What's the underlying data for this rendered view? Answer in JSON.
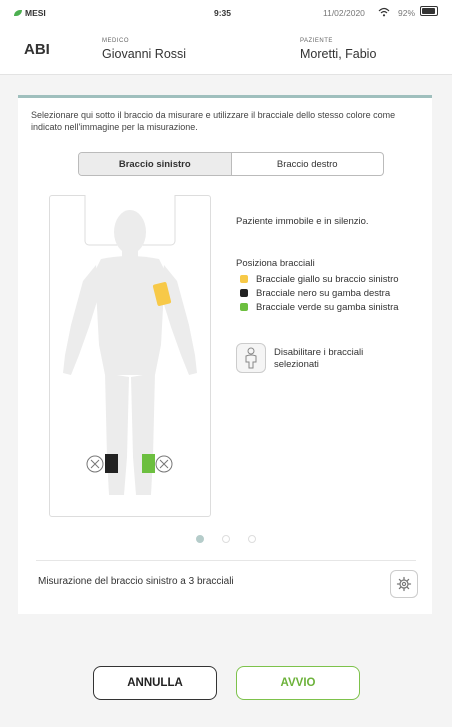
{
  "status_bar": {
    "carrier": "MESI",
    "time": "9:35",
    "date": "11/02/2020",
    "battery": "92%"
  },
  "header": {
    "app_title": "ABI",
    "doctor_label": "MEDICO",
    "doctor_name": "Giovanni Rossi",
    "patient_label": "PAZIENTE",
    "patient_name": "Moretti, Fabio"
  },
  "instructions": "Selezionare qui sotto il braccio da misurare e utilizzare il bracciale dello stesso colore come indicato nell'immagine per la misurazione.",
  "tabs": [
    {
      "label": "Braccio sinistro",
      "active": true
    },
    {
      "label": "Braccio destro",
      "active": false
    }
  ],
  "info": {
    "instruction": "Paziente immobile e in silenzio.",
    "cuff_position_title": "Posiziona bracciali",
    "cuffs": [
      {
        "label": "Bracciale giallo su braccio sinistro",
        "color": "#f7c948"
      },
      {
        "label": "Bracciale nero su gamba destra",
        "color": "#222222"
      },
      {
        "label": "Bracciale verde su gamba sinistra",
        "color": "#6cbf3f"
      }
    ],
    "disable_label": "Disabilitare i bracciali selezionati"
  },
  "pager": {
    "count": 3,
    "active_index": 0
  },
  "footer": {
    "measurement_text": "Misurazione del braccio sinistro a 3 bracciali"
  },
  "buttons": {
    "cancel": "ANNULLA",
    "start": "AVVIO"
  },
  "colors": {
    "accent_green": "#6cb23a",
    "card_top_border": "#9fbfbd"
  }
}
